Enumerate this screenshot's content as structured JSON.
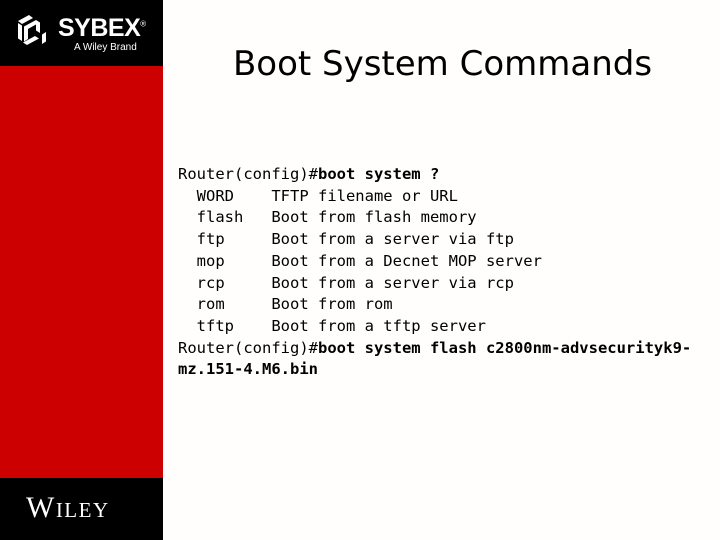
{
  "slide": {
    "title": "Boot System Commands",
    "background_color": "#fffefc"
  },
  "branding": {
    "rail_color": "#cc0000",
    "rail_dark_color": "#000000",
    "sybex_name": "SYBEX",
    "sybex_registered": "®",
    "sybex_tagline": "A Wiley Brand",
    "wiley_name": "Wiley"
  },
  "console": {
    "lines": [
      {
        "prompt": "Router(config)#",
        "command": "boot system ?"
      },
      {
        "prompt": "  WORD    TFTP filename or URL",
        "command": ""
      },
      {
        "prompt": "  flash   Boot from flash memory",
        "command": ""
      },
      {
        "prompt": "  ftp     Boot from a server via ftp",
        "command": ""
      },
      {
        "prompt": "  mop     Boot from a Decnet MOP server",
        "command": ""
      },
      {
        "prompt": "  rcp     Boot from a server via rcp",
        "command": ""
      },
      {
        "prompt": "  rom     Boot from rom",
        "command": ""
      },
      {
        "prompt": "  tftp    Boot from a tftp server",
        "command": ""
      },
      {
        "prompt": "Router(config)#",
        "command": "boot system flash c2800nm-advsecurityk9-mz.151-4.M6.bin"
      }
    ]
  }
}
